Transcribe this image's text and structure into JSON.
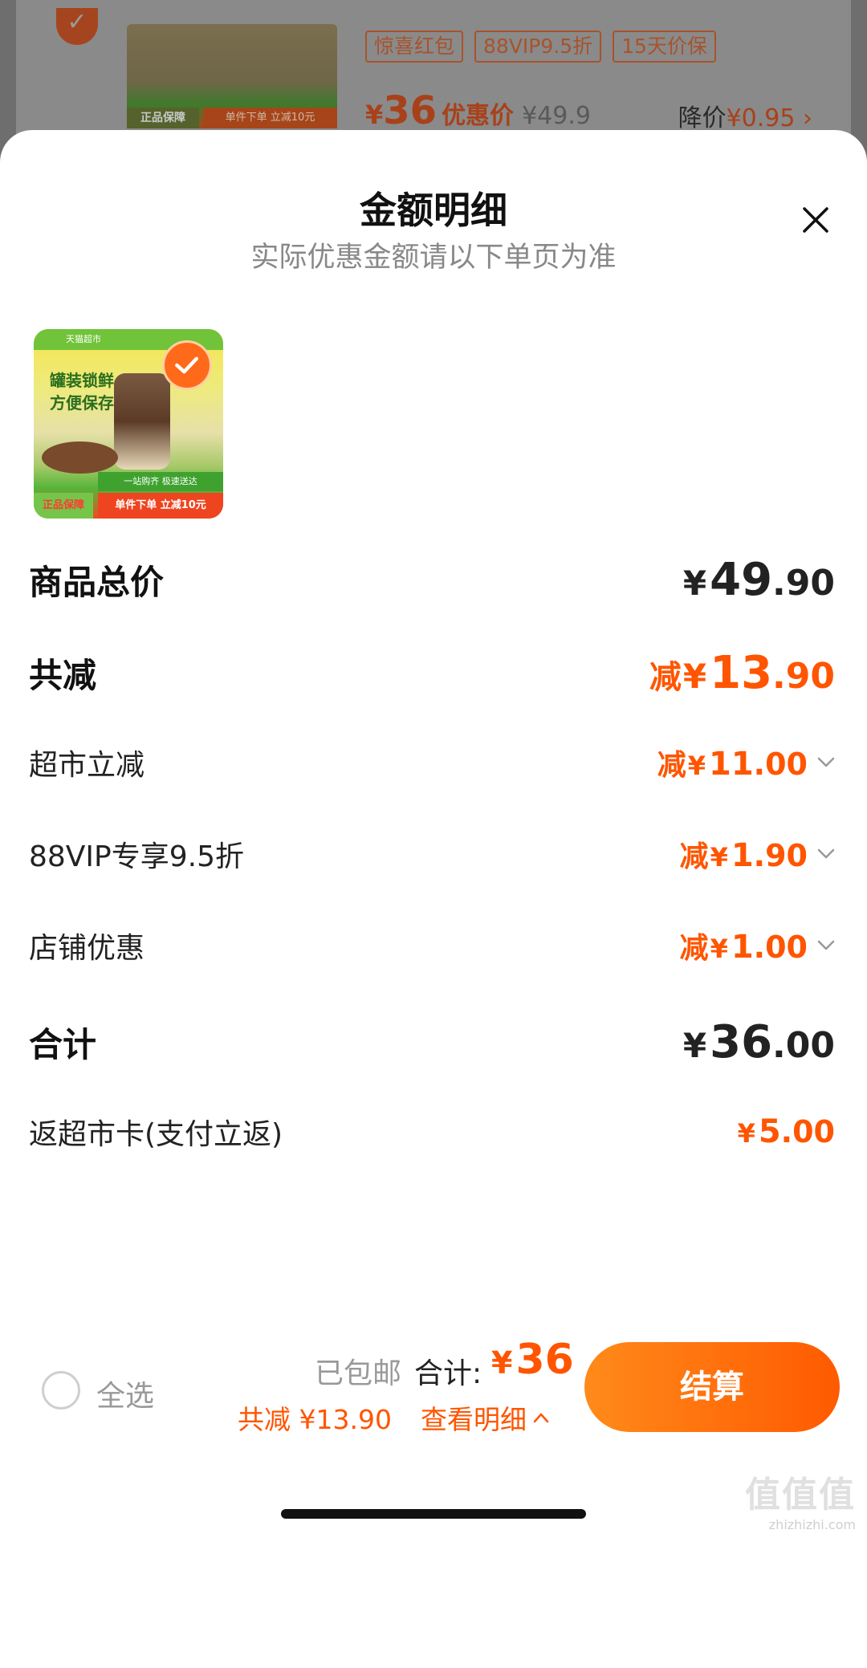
{
  "background_card": {
    "tags": [
      "惊喜红包",
      "88VIP9.5折",
      "15天价保"
    ],
    "price_currency": "¥",
    "price_value": "36",
    "price_label": "优惠价",
    "original_price": "¥49.9",
    "drop_label": "降价",
    "drop_value": "¥0.95 ›"
  },
  "sheet": {
    "title": "金额明细",
    "subtitle": "实际优惠金额请以下单页为准",
    "product_image": {
      "genuine_tag": "正品保障",
      "promo_tag": "单件下单 立减10元",
      "slogan_line1": "罐装锁鲜",
      "slogan_line2": "方便保存",
      "top_banner": "天猫超市",
      "mid_banner": "一站购齐 极速送达"
    }
  },
  "rows": [
    {
      "label": "商品总价",
      "prefix": "",
      "currency": "¥",
      "int": "49",
      "dec": ".90",
      "style": "black",
      "bold": true
    },
    {
      "label": "共减",
      "prefix": "减",
      "currency": "¥",
      "int": "13",
      "dec": ".90",
      "style": "orange",
      "bold": true
    },
    {
      "label": "超市立减",
      "prefix": "减",
      "currency": "¥",
      "int": "11",
      "dec": ".00",
      "style": "orange",
      "bold": false
    },
    {
      "label": "88VIP专享9.5折",
      "prefix": "减",
      "currency": "¥",
      "int": "1",
      "dec": ".90",
      "style": "orange",
      "bold": false
    },
    {
      "label": "店铺优惠",
      "prefix": "减",
      "currency": "¥",
      "int": "1",
      "dec": ".00",
      "style": "orange",
      "bold": false
    },
    {
      "label": "合计",
      "prefix": "",
      "currency": "¥",
      "int": "36",
      "dec": ".00",
      "style": "black",
      "bold": true
    },
    {
      "label": "返超市卡(支付立返)",
      "prefix": "",
      "currency": "¥",
      "int": "5",
      "dec": ".00",
      "style": "orange",
      "bold": false
    }
  ],
  "bottom_bar": {
    "select_all": "全选",
    "free_shipping": "已包邮",
    "total_label": "合计:",
    "total_currency": "¥",
    "total_value": "36",
    "saving_text": "共减 ¥13.90",
    "detail_link": "查看明细",
    "checkout_label": "结算"
  },
  "watermark": {
    "logo": "值值值",
    "url": "zhizhizhi.com"
  },
  "colors": {
    "accent": "#ff5500",
    "checkout_gradient_start": "#ff8a1a",
    "checkout_gradient_end": "#ff5a00"
  }
}
